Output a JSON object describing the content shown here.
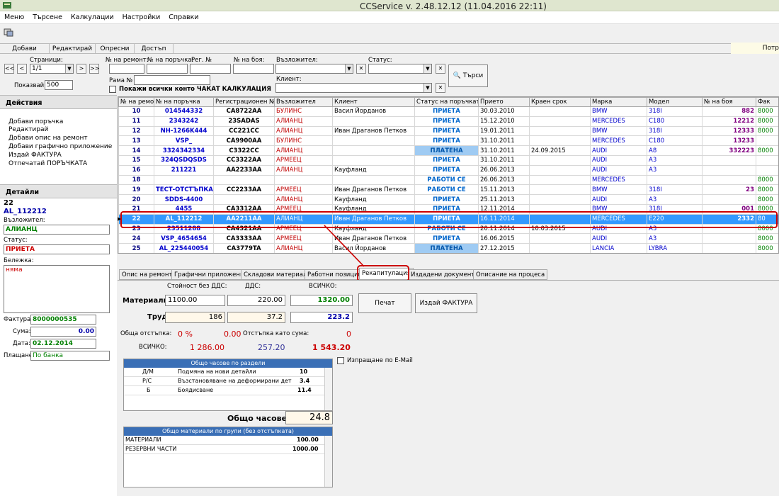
{
  "app": {
    "title": "CCService v. 2.48.12.12 (11.04.2016 22:11)"
  },
  "menu": [
    "Меню",
    "Търсене",
    "Калкулации",
    "Настройки",
    "Справки"
  ],
  "actions_bar": {
    "add": "Добави",
    "edit": "Редактирай",
    "refresh": "Опресни",
    "access": "Достъп",
    "right": "Потр"
  },
  "filters": {
    "pages_label": "Страници:",
    "page_value": "1/1",
    "show_label": "Показвай",
    "show_value": "500",
    "repair_no": "№ на ремонт:",
    "order_no": "№ на поръчка:",
    "reg_no": "Рег. №",
    "paint_no": "№ на боя:",
    "insurer": "Възложител:",
    "status": "Статус:",
    "client": "Клиент:",
    "frame": "Рама №",
    "pending_label": "Покажи всички конто ЧАКАТ КАЛКУЛАЦИЯ",
    "search": "Търси"
  },
  "left": {
    "actions_title": "Действия",
    "actions": [
      "Добави поръчка",
      "Редактирай",
      "Добави опис на ремонт",
      "Добави графично приложение",
      "Издай ФАКТУРА",
      "Отпечатай ПОРЪЧКАТА"
    ],
    "details_title": "Детайли",
    "det_no": "22",
    "det_order": "AL_112212",
    "insurer_label": "Възложител:",
    "insurer_value": "АЛИАНЦ",
    "status_label": "Статус:",
    "status_value": "ПРИЕТА",
    "note_label": "Бележка:",
    "note_value": "няма",
    "invoice_label": "Фактура:",
    "invoice_value": "8000000535",
    "sum_label": "Сума:",
    "sum_value": "0.00",
    "date_label": "Дата:",
    "date_value": "02.12.2014",
    "pay_label": "Плащане:",
    "pay_value": "По банка"
  },
  "grid": {
    "headers": [
      "№ на ремонт",
      "№ на поръчка",
      "Регистрационен №",
      "Възложител",
      "Клиент",
      "Статус на поръчката",
      "Прието",
      "Краен срок",
      "Марка",
      "Модел",
      "№ на боя",
      "Фак"
    ],
    "rows": [
      {
        "no": "10",
        "order": "014544332",
        "reg": "CA8722AA",
        "ins": "БУЛИНС",
        "client": "Васил Йорданов",
        "status": "ПРИЕТА",
        "date": "30.03.2010",
        "deadline": "",
        "brand": "BMW",
        "model": "318I",
        "paint": "882",
        "inv": "8000"
      },
      {
        "no": "11",
        "order": "2343242",
        "reg": "23SADAS",
        "ins": "АЛИАНЦ",
        "client": "",
        "status": "ПРИЕТА",
        "date": "15.12.2010",
        "deadline": "",
        "brand": "MERCEDES",
        "model": "C180",
        "paint": "12212",
        "inv": "8000"
      },
      {
        "no": "12",
        "order": "NH-1266K444",
        "reg": "CC221CC",
        "ins": "АЛИАНЦ",
        "client": "Иван Драганов Петков",
        "status": "ПРИЕТА",
        "date": "19.01.2011",
        "deadline": "",
        "brand": "BMW",
        "model": "318I",
        "paint": "12333",
        "inv": "8000"
      },
      {
        "no": "13",
        "order": "VSP_",
        "reg": "CA9900AA",
        "ins": "БУЛИНС",
        "client": "",
        "status": "ПРИЕТА",
        "date": "31.10.2011",
        "deadline": "",
        "brand": "MERCEDES",
        "model": "C180",
        "paint": "13233",
        "inv": ""
      },
      {
        "no": "14",
        "order": "3324342334",
        "reg": "C3322CC",
        "ins": "АЛИАНЦ",
        "client": "",
        "status": "ПЛАТЕНА",
        "date": "31.10.2011",
        "deadline": "24.09.2015",
        "brand": "AUDI",
        "model": "A8",
        "paint": "332223",
        "inv": "8000"
      },
      {
        "no": "15",
        "order": "324QSDQSDS",
        "reg": "CC3322AA",
        "ins": "АРМЕЕЦ",
        "client": "",
        "status": "ПРИЕТА",
        "date": "31.10.2011",
        "deadline": "",
        "brand": "AUDI",
        "model": "A3",
        "paint": "",
        "inv": ""
      },
      {
        "no": "16",
        "order": "211221",
        "reg": "AA2233AA",
        "ins": "АЛИАНЦ",
        "client": "Кауфланд",
        "status": "ПРИЕТА",
        "date": "26.06.2013",
        "deadline": "",
        "brand": "AUDI",
        "model": "A3",
        "paint": "",
        "inv": ""
      },
      {
        "no": "18",
        "order": "",
        "reg": "",
        "ins": "",
        "client": "",
        "status": "РАБОТИ СЕ",
        "date": "26.06.2013",
        "deadline": "",
        "brand": "MERCEDES",
        "model": "",
        "paint": "",
        "inv": "8000"
      },
      {
        "no": "19",
        "order": "ТЕСТ-ОТСТЪПКА",
        "reg": "CC2233AA",
        "ins": "АРМЕЕЦ",
        "client": "Иван Драганов Петков",
        "status": "РАБОТИ СЕ",
        "date": "15.11.2013",
        "deadline": "",
        "brand": "BMW",
        "model": "318I",
        "paint": "23",
        "inv": "8000"
      },
      {
        "no": "20",
        "order": "SDDS-4400",
        "reg": "",
        "ins": "АЛИАНЦ",
        "client": "Кауфланд",
        "status": "ПРИЕТА",
        "date": "25.11.2013",
        "deadline": "",
        "brand": "AUDI",
        "model": "A3",
        "paint": "",
        "inv": "8000"
      },
      {
        "no": "21",
        "order": "4455",
        "reg": "CA3312AA",
        "ins": "АРМЕЕЦ",
        "client": "Кауфланд",
        "status": "ПРИЕТА",
        "date": "12.11.2014",
        "deadline": "",
        "brand": "BMW",
        "model": "318I",
        "paint": "001",
        "inv": "8000"
      },
      {
        "no": "22",
        "order": "AL_112212",
        "reg": "AA2211AA",
        "ins": "АЛИАНЦ",
        "client": "Иван Драганов Петков",
        "status": "ПРИЕТА",
        "date": "16.11.2014",
        "deadline": "",
        "brand": "MERCEDES",
        "model": "E220",
        "paint": "2332",
        "inv": "80"
      },
      {
        "no": "23",
        "order": "23511288",
        "reg": "CA4321AA",
        "ins": "АРМЕЕЦ",
        "client": "Кауфланд",
        "status": "РАБОТИ СЕ",
        "date": "20.11.2014",
        "deadline": "10.03.2015",
        "brand": "AUDI",
        "model": "A3",
        "paint": "",
        "inv": "8000"
      },
      {
        "no": "24",
        "order": "VSP_4654654",
        "reg": "CA3333AA",
        "ins": "АРМЕЕЦ",
        "client": "Иван Драганов Петков",
        "status": "ПРИЕТА",
        "date": "16.06.2015",
        "deadline": "",
        "brand": "AUDI",
        "model": "A3",
        "paint": "",
        "inv": "8000"
      },
      {
        "no": "25",
        "order": "AL_225440054",
        "reg": "CA3779TA",
        "ins": "АЛИАНЦ",
        "client": "Васил Йорданов",
        "status": "ПЛАТЕНА",
        "date": "27.12.2015",
        "deadline": "",
        "brand": "LANCIA",
        "model": "LYBRA",
        "paint": "",
        "inv": "8000"
      }
    ]
  },
  "tabs": [
    "Опис на ремонта",
    "Графични приложения",
    "Складови материали",
    "Работни позиции",
    "Рекапитулация",
    "Издадени документи",
    "Описание на процеса"
  ],
  "recap": {
    "col_net": "Стойност без ДДС:",
    "col_vat": "ДДС:",
    "col_total": "ВСИЧКО:",
    "materials_label": "Материали:",
    "materials_net": "1100.00",
    "materials_vat": "220.00",
    "materials_total": "1320.00",
    "labor_label": "Труд:",
    "labor_net": "186",
    "labor_vat": "37.2",
    "labor_total": "223.2",
    "discount_label": "Обща отстъпка:",
    "discount_pct": "0 %",
    "discount_val": "0.00",
    "discount_sum_label": "Отстъпка като сума:",
    "discount_sum": "0",
    "all_label": "ВСИЧКО:",
    "all_net": "1 286.00",
    "all_vat": "257.20",
    "all_total": "1 543.20",
    "print": "Печат",
    "invoice": "Издай ФАКТУРА",
    "email": "Изпращане по E-Mail",
    "hours_title": "Общо часове по раздели",
    "hours": [
      {
        "code": "Д/М",
        "name": "Подмяна на нови детайли",
        "val": "10"
      },
      {
        "code": "Р/С",
        "name": "Възстановяване на деформирани дет",
        "val": "3.4"
      },
      {
        "code": "Б",
        "name": "Боядисване",
        "val": "11.4"
      }
    ],
    "total_hours_label": "Общо часове:",
    "total_hours": "24.8",
    "mat_title": "Общо материали по групи (без отстъпката)",
    "mats": [
      {
        "name": "МАТЕРИАЛИ",
        "val": "100.00"
      },
      {
        "name": "РЕЗЕРВНИ ЧАСТИ",
        "val": "1000.00"
      }
    ]
  },
  "colors": {
    "accent": "#3399ff",
    "highlight": "#cc0000",
    "paid": "#9fcbf3"
  }
}
